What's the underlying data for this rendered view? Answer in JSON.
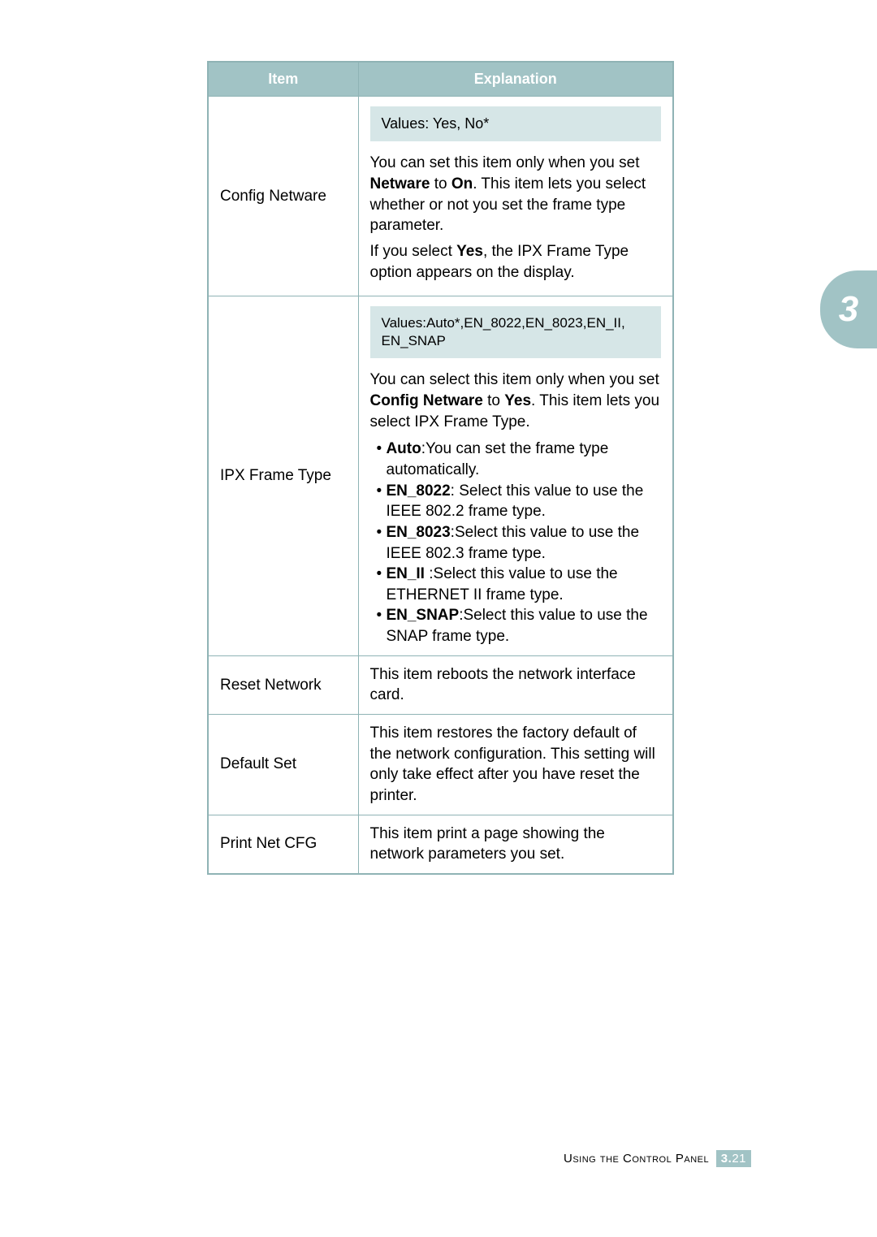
{
  "sideTab": "3",
  "headers": {
    "item": "Item",
    "explanation": "Explanation"
  },
  "rows": {
    "configNetware": {
      "item": "Config Netware",
      "values": "Values: Yes, No*",
      "p1a": "You can set this item only when you set ",
      "p1b": "Netware",
      "p1c": " to ",
      "p1d": "On",
      "p1e": ". This item lets you select whether or not you set the frame type parameter.",
      "p2a": "If you select ",
      "p2b": "Yes",
      "p2c": ", the IPX Frame Type option appears on the display."
    },
    "ipxFrameType": {
      "item": "IPX Frame Type",
      "values": "Values:Auto*,EN_8022,EN_8023,EN_II, EN_SNAP",
      "p1a": "You can select this item only when you set ",
      "p1b": "Config Netware",
      "p1c": " to ",
      "p1d": "Yes",
      "p1e": ". This item lets you select IPX Frame Type.",
      "b1a": "• ",
      "b1b": "Auto",
      "b1c": ":You can set the frame type automatically.",
      "b2a": "• ",
      "b2b": "EN_8022",
      "b2c": ": Select this value to use the IEEE 802.2 frame type.",
      "b3a": "• ",
      "b3b": "EN_8023",
      "b3c": ":Select this value to use the IEEE 802.3 frame type.",
      "b4a": "• ",
      "b4b": "EN_II",
      "b4c": " :Select this value to use the ETHERNET II frame type.",
      "b5a": "• ",
      "b5b": "EN_SNAP",
      "b5c": ":Select this value to use the SNAP frame type."
    },
    "resetNetwork": {
      "item": "Reset Network",
      "desc": "This item reboots the network interface card."
    },
    "defaultSet": {
      "item": "Default Set",
      "desc": "This item restores the factory default of the network configuration. This setting will only take effect after you have reset the printer."
    },
    "printNetCfg": {
      "item": "Print Net CFG",
      "desc": "This item print a page showing the network parameters you set."
    }
  },
  "footer": {
    "label": "Using the Control Panel",
    "chapter": "3.",
    "page": "21"
  }
}
